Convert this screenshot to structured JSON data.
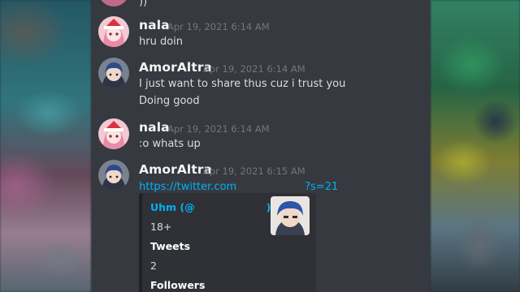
{
  "top_partial_text": "))",
  "messages": [
    {
      "user": "nala",
      "timestamp": "Apr 19, 2021 6:14 AM",
      "lines": [
        "hru doin"
      ]
    },
    {
      "user": "AmorAltra",
      "timestamp": "Apr 19, 2021 6:14 AM",
      "lines": [
        "I just want to share thus cuz i trust you",
        "Doing good"
      ]
    },
    {
      "user": "nala",
      "timestamp": "Apr 19, 2021 6:14 AM",
      "lines": [
        ":o whats up"
      ]
    },
    {
      "user": "AmorAltra",
      "timestamp": "Apr 19, 2021 6:15 AM",
      "link_start": "https://twitter.com",
      "link_end": "?s=21"
    }
  ],
  "embed": {
    "author_prefix": "Uhm (@",
    "author_suffix": ")",
    "description": "18+",
    "fields": [
      {
        "name": "Tweets",
        "value": "2"
      },
      {
        "name": "Followers",
        "value": ""
      }
    ]
  },
  "colors": {
    "panel_bg": "#36393f",
    "username": "#f4f4f5",
    "timestamp": "#72767d",
    "message_text": "#dcddde",
    "link": "#00b0f4",
    "embed_bg": "#2f3136"
  }
}
